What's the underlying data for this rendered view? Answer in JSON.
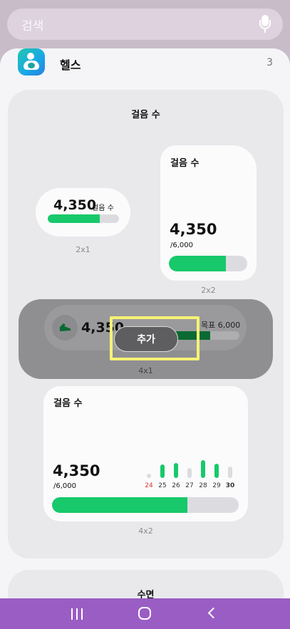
{
  "search": {
    "placeholder": "검색"
  },
  "app": {
    "name": "헬스",
    "count": "3"
  },
  "steps_section": {
    "title": "걸음 수",
    "widget_2x1": {
      "value": "4,350",
      "unit": "걸음 수",
      "progress": 0.725,
      "size": "2x1"
    },
    "widget_2x2": {
      "title": "걸음 수",
      "value": "4,350",
      "goal": "/6,000",
      "progress": 0.725,
      "size": "2x2"
    },
    "widget_4x1": {
      "value": "4,350",
      "goal": "목표 6,000",
      "progress": 0.725,
      "size": "4x1",
      "add_label": "추가"
    },
    "widget_4x2": {
      "title": "걸음 수",
      "value": "4,350",
      "goal": "/6,000",
      "progress": 0.725,
      "size": "4x2",
      "days": [
        {
          "label": "24",
          "level": 0.15,
          "gray": true,
          "red": true
        },
        {
          "label": "25",
          "level": 0.55,
          "gray": false
        },
        {
          "label": "26",
          "level": 0.62,
          "gray": false
        },
        {
          "label": "27",
          "level": 0.4,
          "gray": true
        },
        {
          "label": "28",
          "level": 0.75,
          "gray": false
        },
        {
          "label": "29",
          "level": 0.6,
          "gray": false
        },
        {
          "label": "30",
          "level": 0.48,
          "gray": true,
          "bold": true
        }
      ]
    }
  },
  "sleep_section": {
    "title": "수면"
  },
  "colors": {
    "green": "#17c96a",
    "highlight": "#f6f274",
    "nav": "#9a5dc4"
  }
}
